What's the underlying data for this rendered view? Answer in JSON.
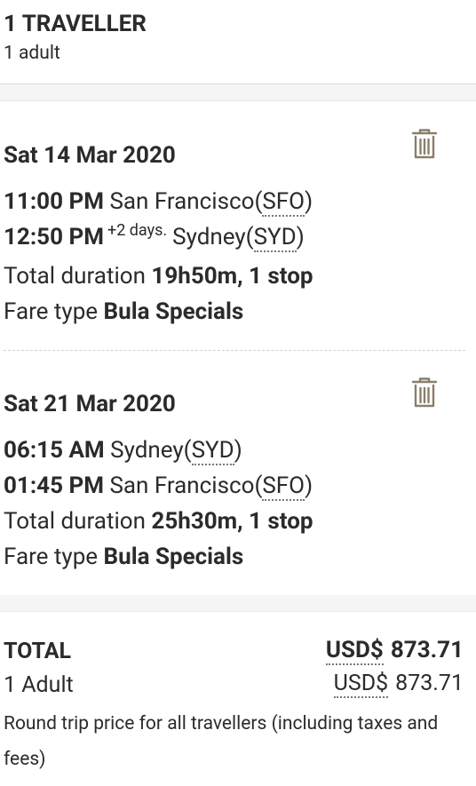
{
  "travellers": {
    "title": "1 TRAVELLER",
    "subtitle": "1 adult"
  },
  "legs": [
    {
      "date": "Sat 14 Mar 2020",
      "depart_time": "11:00 PM",
      "depart_city": "San Francisco(",
      "depart_code": "SFO",
      "arrive_time": "12:50 PM",
      "arrive_days": "+2 days.",
      "arrive_city": "Sydney(",
      "arrive_code": "SYD",
      "duration_label": "Total duration",
      "duration_value": "19h50m, 1 stop",
      "fare_label": "Fare type",
      "fare_value": "Bula Specials",
      "delete_icon": "trash-icon"
    },
    {
      "date": "Sat 21 Mar 2020",
      "depart_time": "06:15 AM",
      "depart_city": "Sydney(",
      "depart_code": "SYD",
      "arrive_time": "01:45 PM",
      "arrive_city": "San Francisco(",
      "arrive_code": "SFO",
      "duration_label": "Total duration",
      "duration_value": "25h30m, 1 stop",
      "fare_label": "Fare type",
      "fare_value": "Bula Specials",
      "delete_icon": "trash-icon"
    }
  ],
  "summary": {
    "total_label": "TOTAL",
    "total_currency": "USD$",
    "total_amount": "873.71",
    "adult_label": "1 Adult",
    "adult_currency": "USD$",
    "adult_amount": "873.71",
    "note": "Round trip price for all travellers (including taxes and fees)"
  },
  "colors": {
    "text": "#2b2b2b",
    "icon": "#8a7e6a",
    "divider": "#cfcfcf",
    "gap": "#f5f5f5"
  }
}
